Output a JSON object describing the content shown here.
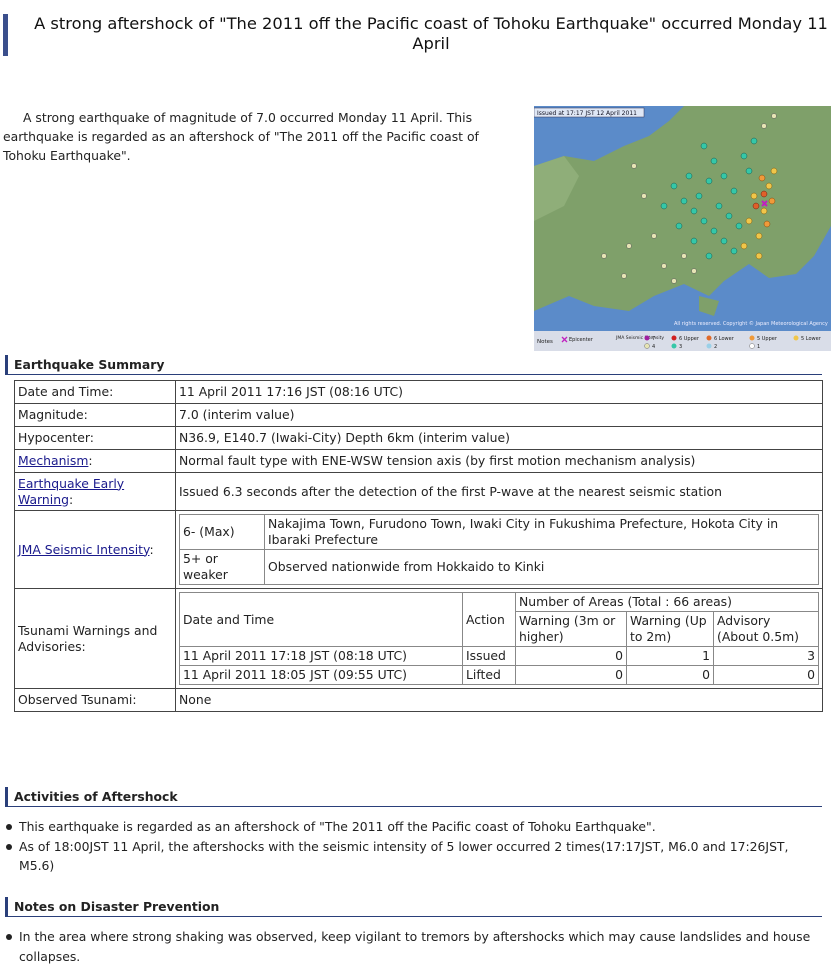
{
  "title": "A strong aftershock of \"The 2011 off the Pacific coast of Tohoku Earthquake\" occurred Monday 11 April",
  "intro": "A strong earthquake of magnitude of 7.0 occurred Monday 11 April. This earthquake is regarded as an aftershock of \"The 2011 off the Pacific coast of Tohoku Earthquake\".",
  "map": {
    "issued_label": "Issued at 17:17 JST 12 April 2011",
    "copyright": "All rights reserved. Copyright © Japan Meteorological Agency",
    "legend": {
      "notes": "Notes",
      "epicenter": "Epicenter",
      "jma_label": "JMA Seismic Intensity",
      "items": [
        "7",
        "6 Upper",
        "6 Lower",
        "5 Upper",
        "5 Lower",
        "4",
        "3",
        "2",
        "1"
      ]
    },
    "colors": {
      "sea": "#5b8bc9",
      "land": "#7fa06a",
      "i3": "#35c7a8",
      "i4": "#e6e4b4",
      "i5l": "#f0c64a",
      "i5u": "#f09a3a",
      "i6l": "#e0602a"
    }
  },
  "summary": {
    "heading": "Earthquake Summary",
    "rows": {
      "datetime": {
        "label": "Date and Time:",
        "value": "11 April 2011 17:16 JST (08:16 UTC)"
      },
      "magnitude": {
        "label": "Magnitude:",
        "value": "7.0 (interim value)"
      },
      "hypocenter": {
        "label": "Hypocenter:",
        "value": "N36.9, E140.7 (Iwaki-City) Depth 6km (interim value)"
      },
      "mechanism": {
        "link": "Mechanism",
        "suffix": ":",
        "value": "Normal fault type with ENE-WSW tension axis (by first motion mechanism analysis)"
      },
      "eew": {
        "link": "Earthquake Early Warning",
        "suffix": ":",
        "value": "Issued 6.3 seconds after the detection of the first P-wave at the nearest seismic station"
      },
      "intensity": {
        "link": "JMA Seismic Intensity",
        "suffix": ":",
        "rows": [
          {
            "level": "6- (Max)",
            "places": "Nakajima Town, Furudono Town, Iwaki City in Fukushima Prefecture, Hokota City in Ibaraki Prefecture"
          },
          {
            "level": "5+ or weaker",
            "places": "Observed nationwide from Hokkaido to Kinki"
          }
        ]
      },
      "tsunami": {
        "label": "Tsunami Warnings and Advisories:",
        "headers": {
          "datetime": "Date and Time",
          "action": "Action",
          "areas": "Number of Areas (Total : 66 areas)",
          "warning3": "Warning (3m or higher)",
          "warning2": "Warning (Up to 2m)",
          "advisory": "Advisory (About 0.5m)"
        },
        "rows": [
          {
            "datetime": "11 April 2011 17:18 JST (08:18 UTC)",
            "action": "Issued",
            "warning3": "0",
            "warning2": "1",
            "advisory": "3"
          },
          {
            "datetime": "11 April 2011 18:05 JST (09:55 UTC)",
            "action": "Lifted",
            "warning3": "0",
            "warning2": "0",
            "advisory": "0"
          }
        ]
      },
      "observed": {
        "label": "Observed Tsunami:",
        "value": "None"
      }
    }
  },
  "activities": {
    "heading": "Activities of Aftershock",
    "items": [
      "This earthquake is regarded as an aftershock of \"The 2011 off the Pacific coast of Tohoku Earthquake\".",
      "As of 18:00JST 11 April, the aftershocks with the seismic intensity of 5 lower occurred 2 times(17:17JST, M6.0 and 17:26JST, M5.6)"
    ]
  },
  "notes": {
    "heading": "Notes on Disaster Prevention",
    "items": [
      "In the area where strong shaking was observed, keep vigilant to tremors by aftershocks which may cause landslides and house collapses."
    ]
  }
}
